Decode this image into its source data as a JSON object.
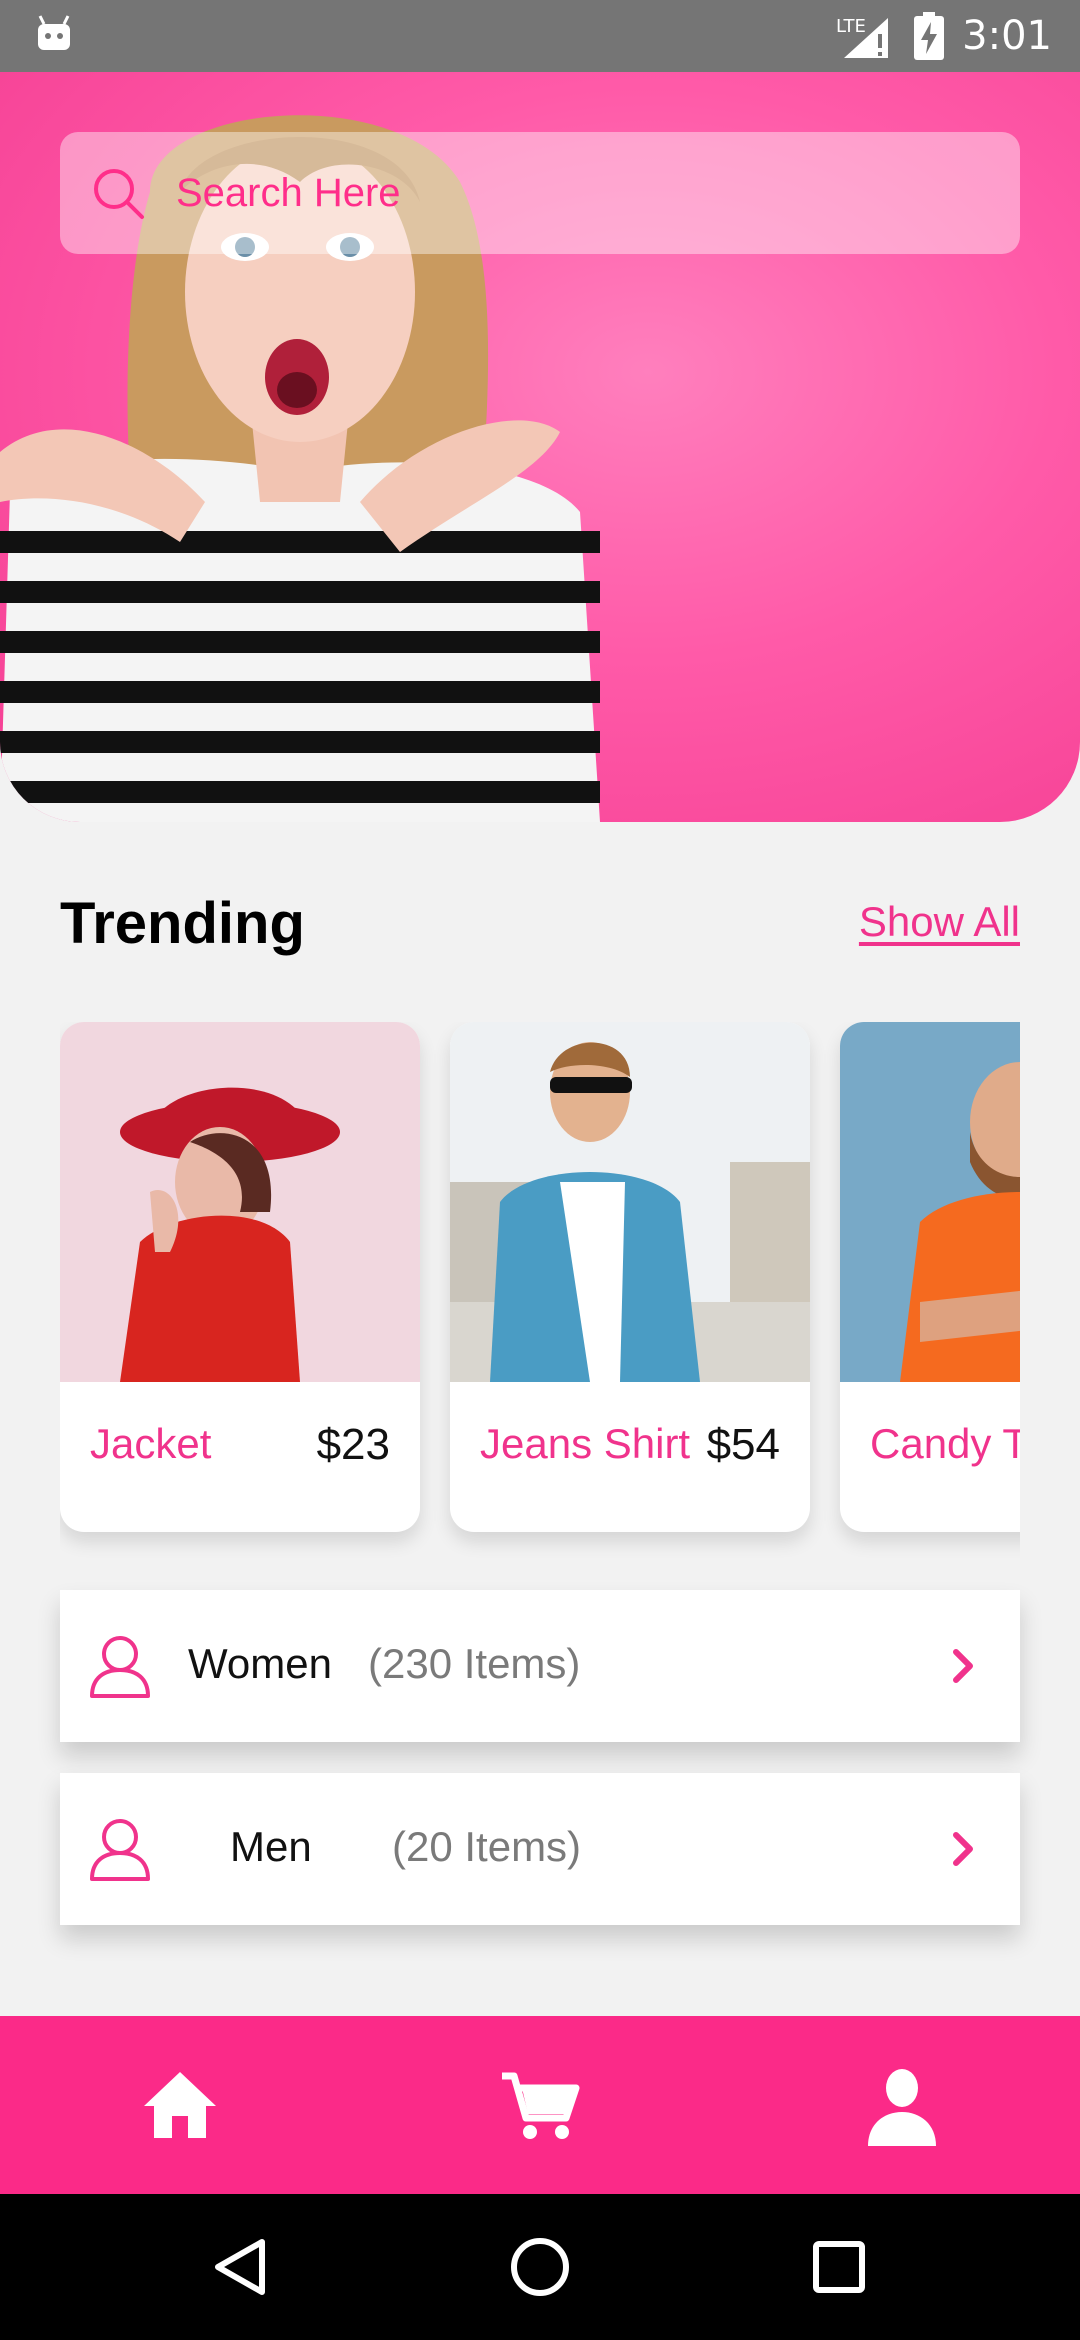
{
  "status_bar": {
    "time": "3:01",
    "network": "LTE",
    "icons": [
      "android-debug-icon",
      "signal-icon",
      "battery-charging-icon"
    ]
  },
  "hero": {
    "search": {
      "placeholder": "Search Here",
      "icon": "search-icon"
    }
  },
  "trending": {
    "title": "Trending",
    "show_all_label": "Show All",
    "products": [
      {
        "name": "Jacket",
        "price": "$23"
      },
      {
        "name": "Jeans Shirt",
        "price": "$54"
      },
      {
        "name": "Candy T",
        "price": ""
      }
    ]
  },
  "categories": [
    {
      "name": "Women",
      "count": "(230 Items)",
      "icon": "user-icon"
    },
    {
      "name": "Men",
      "count": "(20 Items)",
      "icon": "user-icon"
    }
  ],
  "bottom_nav": {
    "items": [
      "home-icon",
      "cart-icon",
      "profile-icon"
    ]
  },
  "system_nav": {
    "items": [
      "back-icon",
      "home-circle-icon",
      "recents-icon"
    ]
  },
  "colors": {
    "accent": "#fb2a88",
    "accent_text": "#f0338c",
    "hero_pink": "#ff5aa8",
    "background": "#f2f2f2"
  }
}
